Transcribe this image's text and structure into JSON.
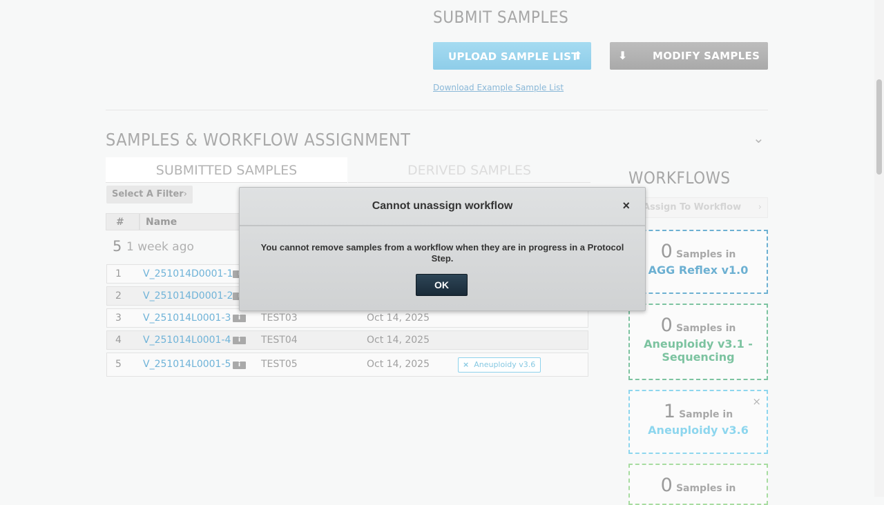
{
  "submit": {
    "title": "SUBMIT SAMPLES",
    "upload_label": "UPLOAD SAMPLE LIST",
    "modify_label": "MODIFY SAMPLES",
    "download_link": "Download Example Sample List"
  },
  "assignment": {
    "title": "SAMPLES & WORKFLOW ASSIGNMENT",
    "tabs": [
      {
        "label": "SUBMITTED SAMPLES",
        "active": true
      },
      {
        "label": "DERIVED SAMPLES",
        "active": false
      }
    ],
    "filter_label": "Select A Filter",
    "columns": [
      "#",
      "Name"
    ],
    "group": {
      "count": "5",
      "label": "1 week ago"
    },
    "rows": [
      {
        "num": "1",
        "name": "V_251014D0001-1",
        "note": "",
        "date": "",
        "tag": ""
      },
      {
        "num": "2",
        "name": "V_251014D0001-2",
        "note": "",
        "date": "",
        "tag": ""
      },
      {
        "num": "3",
        "name": "V_251014L0001-3",
        "note": "TEST03",
        "date": "Oct 14, 2025",
        "tag": ""
      },
      {
        "num": "4",
        "name": "V_251014L0001-4",
        "note": "TEST04",
        "date": "Oct 14, 2025",
        "tag": ""
      },
      {
        "num": "5",
        "name": "V_251014L0001-5",
        "note": "TEST05",
        "date": "Oct 14, 2025",
        "tag": "Aneuploidy v3.6"
      }
    ]
  },
  "workflows": {
    "title": "WORKFLOWS",
    "assign_label": "Assign To Workflow",
    "cards": [
      {
        "count": "0",
        "label": "Samples in",
        "name": "AGG Reflex v1.0",
        "color": "#6cb0d2"
      },
      {
        "count": "0",
        "label": "Samples in",
        "name": "Aneuploidy v3.1 - Sequencing",
        "color": "#7cc3a0"
      },
      {
        "count": "1",
        "label": "Sample in",
        "name": "Aneuploidy v3.6",
        "color": "#8dd6ee"
      },
      {
        "count": "0",
        "label": "Samples in",
        "name": "",
        "color": "#a7dca0"
      }
    ]
  },
  "dialog": {
    "title": "Cannot unassign workflow",
    "message": "You cannot remove samples from a workflow when they are in progress in a Protocol Step.",
    "ok_label": "OK",
    "close_glyph": "×"
  },
  "icons": {
    "info": "i",
    "up_arrow": "⬆",
    "down_arrow": "⬇",
    "chevron": "›",
    "collapse": "⌄",
    "remove": "×"
  }
}
